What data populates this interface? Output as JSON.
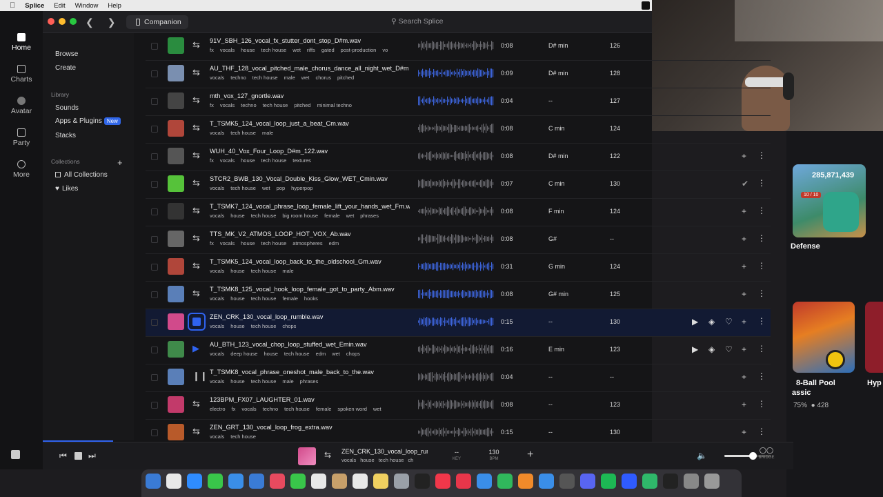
{
  "menubar": {
    "app": "Splice",
    "items": [
      "Edit",
      "Window",
      "Help"
    ]
  },
  "window": {
    "companion": "Companion",
    "search_placeholder": "Search Splice"
  },
  "rail": [
    {
      "label": "Home",
      "icon": "home-icon",
      "active": true
    },
    {
      "label": "Charts",
      "icon": "charts-icon"
    },
    {
      "label": "Avatar",
      "icon": "avatar-icon"
    },
    {
      "label": "Party",
      "icon": "party-icon"
    },
    {
      "label": "More",
      "icon": "more-icon"
    }
  ],
  "sidebar": {
    "browse": "Browse",
    "create": "Create",
    "library_header": "Library",
    "sounds": "Sounds",
    "apps_plugins": "Apps & Plugins",
    "new_badge": "New",
    "stacks": "Stacks",
    "collections_header": "Collections",
    "all_collections": "All Collections",
    "likes": "Likes"
  },
  "rows": [
    {
      "name": "91V_SBH_126_vocal_fx_stutter_dont_stop_D#m.wav",
      "tags": [
        "fx",
        "vocals",
        "house",
        "tech house",
        "wet",
        "riffs",
        "gated",
        "post-production",
        "vo"
      ],
      "dur": "0:08",
      "key": "D# min",
      "bpm": "126",
      "art": "#2a8c3f",
      "wave": "#6a6a70",
      "state": ""
    },
    {
      "name": "AU_THF_128_vocal_pitched_male_chorus_dance_all_night_wet_D#m",
      "tags": [
        "vocals",
        "techno",
        "tech house",
        "male",
        "wet",
        "chorus",
        "pitched"
      ],
      "dur": "0:09",
      "key": "D# min",
      "bpm": "128",
      "art": "#7a8fb0",
      "wave": "#3c63d8",
      "state": ""
    },
    {
      "name": "mth_vox_127_gnortle.wav",
      "tags": [
        "fx",
        "vocals",
        "techno",
        "tech house",
        "pitched",
        "minimal techno"
      ],
      "dur": "0:04",
      "key": "--",
      "bpm": "127",
      "art": "#444",
      "wave": "#3c63d8",
      "state": ""
    },
    {
      "name": "T_TSMK5_124_vocal_loop_just_a_beat_Cm.wav",
      "tags": [
        "vocals",
        "tech house",
        "male"
      ],
      "dur": "0:08",
      "key": "C min",
      "bpm": "124",
      "art": "#b0463a",
      "wave": "#6a6a70",
      "state": ""
    },
    {
      "name": "WUH_40_Vox_Four_Loop_D#m_122.wav",
      "tags": [
        "fx",
        "vocals",
        "house",
        "tech house",
        "textures"
      ],
      "dur": "0:08",
      "key": "D# min",
      "bpm": "122",
      "art": "#555",
      "wave": "#6a6a70",
      "state": "plus"
    },
    {
      "name": "STCR2_BWB_130_Vocal_Double_Kiss_Glow_WET_Cmin.wav",
      "tags": [
        "vocals",
        "tech house",
        "wet",
        "pop",
        "hyperpop"
      ],
      "dur": "0:07",
      "key": "C min",
      "bpm": "130",
      "art": "#56c23a",
      "wave": "#6a6a70",
      "state": "check"
    },
    {
      "name": "T_TSMK7_124_vocal_phrase_loop_female_lift_your_hands_wet_Fm.w",
      "tags": [
        "vocals",
        "house",
        "tech house",
        "big room house",
        "female",
        "wet",
        "phrases"
      ],
      "dur": "0:08",
      "key": "F min",
      "bpm": "124",
      "art": "#333",
      "wave": "#6a6a70",
      "state": "plus"
    },
    {
      "name": "TTS_MK_V2_ATMOS_LOOP_HOT_VOX_Ab.wav",
      "tags": [
        "fx",
        "vocals",
        "house",
        "tech house",
        "atmospheres",
        "edm"
      ],
      "dur": "0:08",
      "key": "G#",
      "bpm": "--",
      "art": "#666",
      "wave": "#6a6a70",
      "state": "plus"
    },
    {
      "name": "T_TSMK5_124_vocal_loop_back_to_the_oldschool_Gm.wav",
      "tags": [
        "vocals",
        "house",
        "tech house",
        "male"
      ],
      "dur": "0:31",
      "key": "G min",
      "bpm": "124",
      "art": "#b0463a",
      "wave": "#3c63d8",
      "state": "plus"
    },
    {
      "name": "T_TSMK8_125_vocal_hook_loop_female_got_to_party_Abm.wav",
      "tags": [
        "vocals",
        "house",
        "tech house",
        "female",
        "hooks"
      ],
      "dur": "0:08",
      "key": "G# min",
      "bpm": "125",
      "art": "#5a7fb8",
      "wave": "#3c63d8",
      "state": "plus"
    },
    {
      "name": "ZEN_CRK_130_vocal_loop_rumble.wav",
      "tags": [
        "vocals",
        "house",
        "tech house",
        "chops"
      ],
      "dur": "0:15",
      "key": "--",
      "bpm": "130",
      "art": "#d14a8b",
      "wave": "#3c63d8",
      "state": "full",
      "highlight": true,
      "playing": true
    },
    {
      "name": "AU_BTH_123_vocal_chop_loop_stuffed_wet_Emin.wav",
      "tags": [
        "vocals",
        "deep house",
        "house",
        "tech house",
        "edm",
        "wet",
        "chops"
      ],
      "dur": "0:16",
      "key": "E min",
      "bpm": "123",
      "art": "#3f8a4a",
      "wave": "#6a6a70",
      "state": "full",
      "hover": true
    },
    {
      "name": "T_TSMK8_vocal_phrase_oneshot_male_back_to_the.wav",
      "tags": [
        "vocals",
        "house",
        "tech house",
        "male",
        "phrases"
      ],
      "dur": "0:04",
      "key": "--",
      "bpm": "--",
      "art": "#5a7fb8",
      "wave": "#6a6a70",
      "state": "plus",
      "oneshot": true
    },
    {
      "name": "123BPM_FX07_LAUGHTER_01.wav",
      "tags": [
        "electro",
        "fx",
        "vocals",
        "techno",
        "tech house",
        "female",
        "spoken word",
        "wet"
      ],
      "dur": "0:08",
      "key": "--",
      "bpm": "123",
      "art": "#c23a6a",
      "wave": "#6a6a70",
      "state": "plus"
    },
    {
      "name": "ZEN_GRT_130_vocal_loop_frog_extra.wav",
      "tags": [
        "vocals",
        "tech house"
      ],
      "dur": "0:15",
      "key": "--",
      "bpm": "130",
      "art": "#b85a2a",
      "wave": "#6a6a70",
      "state": "plus"
    }
  ],
  "player": {
    "file": "ZEN_CRK_130_vocal_loop_rumble.wav",
    "tags": [
      "vocals",
      "house",
      "tech house",
      "ch"
    ],
    "key_value": "--",
    "key_label": "KEY",
    "bpm_value": "130",
    "bpm_label": "BPM",
    "bridge_label": "BRIDGE",
    "progress": 0.1,
    "volume": 0.6
  },
  "games": {
    "card1_counter": "285,871,439",
    "card1_badge": "10 / 10",
    "card1_title": "Defense",
    "card2_title_a": "8-Ball Pool",
    "card2_title_b": "assic",
    "card3_title": "Hyp",
    "card2_rating": "75%",
    "card2_players": "428"
  },
  "colors": {
    "accent": "#2f63f0",
    "highlight_row": "#121a33",
    "background": "#151517"
  }
}
